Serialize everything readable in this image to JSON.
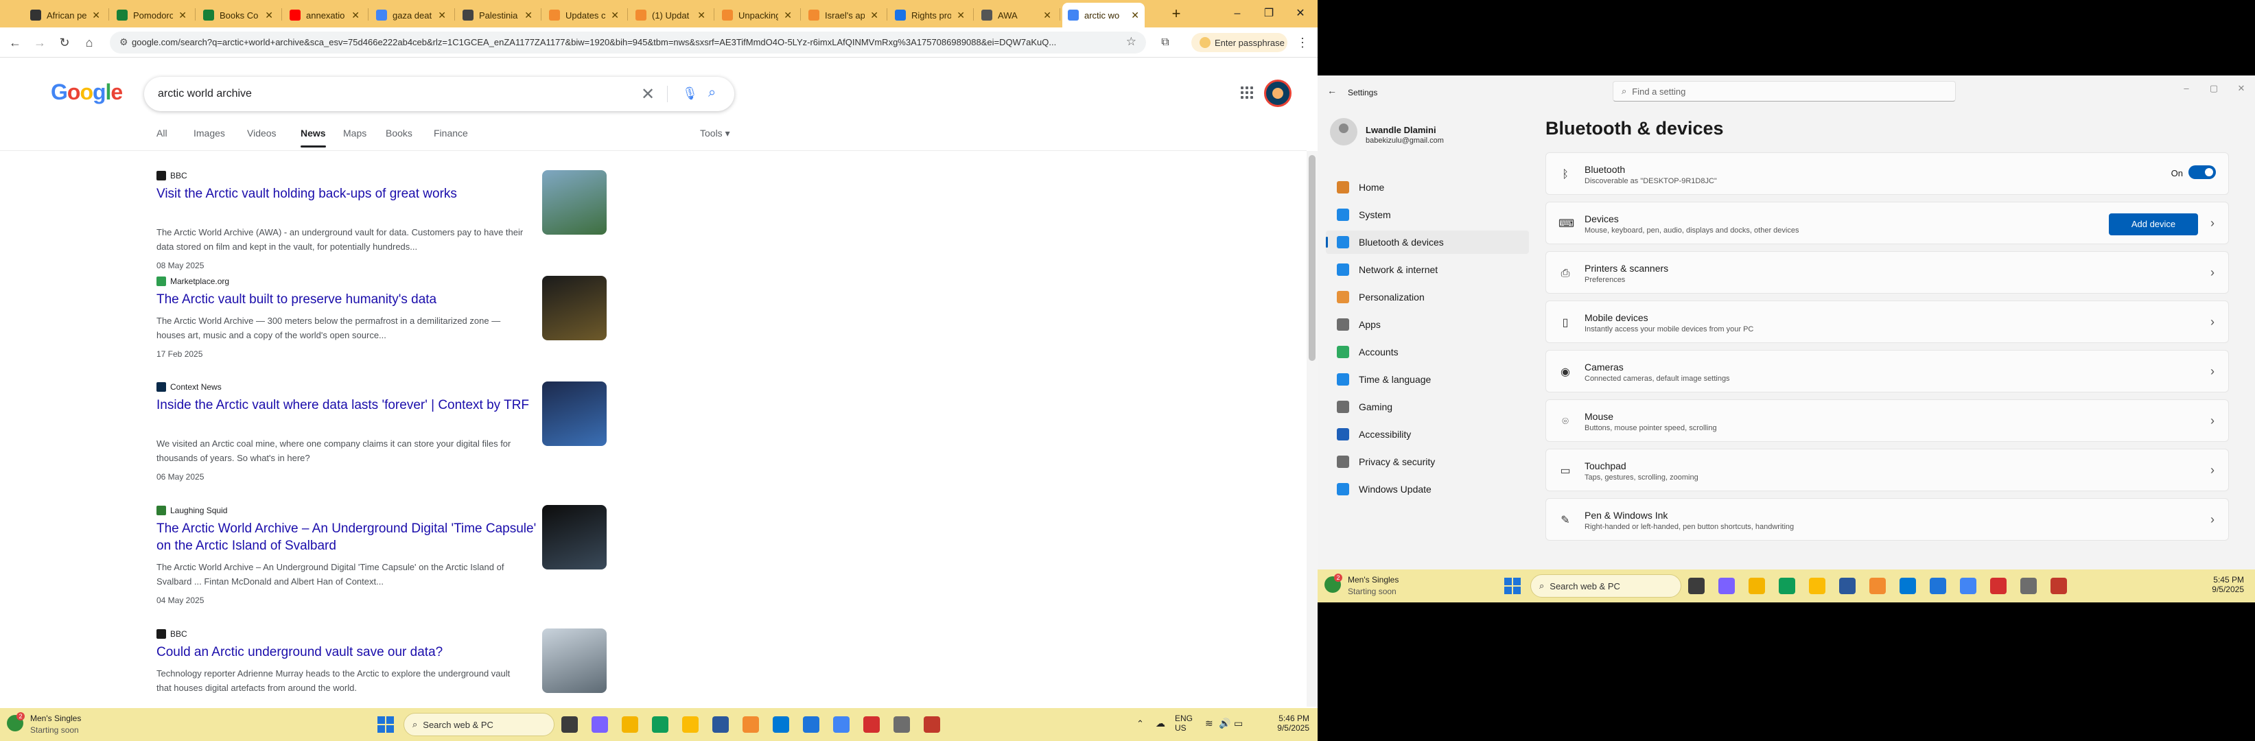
{
  "browser": {
    "tabs": [
      {
        "label": "African pe",
        "favicon_color": "#333333"
      },
      {
        "label": "Pomodoro",
        "favicon_color": "#188038"
      },
      {
        "label": "Books Co",
        "favicon_color": "#188038"
      },
      {
        "label": "annexatio",
        "favicon_color": "#ff0000"
      },
      {
        "label": "gaza deat",
        "favicon_color": "#4285f4"
      },
      {
        "label": "Palestinia",
        "favicon_color": "#444444"
      },
      {
        "label": "Updates c",
        "favicon_color": "#f28b30"
      },
      {
        "label": "(1) Updat",
        "favicon_color": "#f28b30"
      },
      {
        "label": "Unpacking",
        "favicon_color": "#f28b30"
      },
      {
        "label": "Israel's ap",
        "favicon_color": "#f28b30"
      },
      {
        "label": "Rights pro",
        "favicon_color": "#1a73e8"
      },
      {
        "label": "AWA",
        "favicon_color": "#555555"
      },
      {
        "label": "arctic wo",
        "favicon_color": "#4285f4",
        "active": true
      }
    ],
    "url": "google.com/search?q=arctic+world+archive&sca_esv=75d466e222ab4ceb&rlz=1C1GCEA_enZA1177ZA1177&biw=1920&bih=945&tbm=nws&sxsrf=AE3TifMmdO4O-5LYz-r6imxLAfQINMVmRxg%3A1757086989088&ei=DQW7aKuQ...",
    "passphrase_label": "Enter passphrase"
  },
  "google": {
    "logo": "Google",
    "query": "arctic world archive",
    "tabs": [
      "All",
      "Images",
      "Videos",
      "News",
      "Maps",
      "Books",
      "Finance"
    ],
    "active_tab": "News",
    "tools_label": "Tools",
    "results": [
      {
        "source": "BBC",
        "source_color": "#1a1a1a",
        "title": "Visit the Arctic vault holding back-ups of great works",
        "snippet": "The Arctic World Archive (AWA) - an underground vault for data. Customers pay to have their data stored on film and kept in the vault, for potentially hundreds...",
        "date": "08 May 2025",
        "thumb_colors": [
          "#7fa7c2",
          "#3e6f3f"
        ]
      },
      {
        "source": "Marketplace.org",
        "source_color": "#2e9e4f",
        "title": "The Arctic vault built to preserve humanity's data",
        "snippet": "The Arctic World Archive — 300 meters below the permafrost in a demilitarized zone — houses art, music and a copy of the world's open source...",
        "date": "17 Feb 2025",
        "thumb_colors": [
          "#1b1b1b",
          "#6e5a2a"
        ]
      },
      {
        "source": "Context News",
        "source_color": "#0a2a4a",
        "title": "Inside the Arctic vault where data lasts 'forever' | Context by TRF",
        "snippet": "We visited an Arctic coal mine, where one company claims it can store your digital files for thousands of years. So what's in here?",
        "date": "06 May 2025",
        "thumb_colors": [
          "#1c2a4d",
          "#3a6fb5"
        ]
      },
      {
        "source": "Laughing Squid",
        "source_color": "#2e7d32",
        "title": "The Arctic World Archive – An Underground Digital 'Time Capsule' on the Arctic Island of Svalbard",
        "snippet": "The Arctic World Archive – An Underground Digital 'Time Capsule' on the Arctic Island of Svalbard ... Fintan McDonald and Albert Han of Context...",
        "date": "04 May 2025",
        "thumb_colors": [
          "#0d0d0d",
          "#3a4a5a"
        ]
      },
      {
        "source": "BBC",
        "source_color": "#1a1a1a",
        "title": "Could an Arctic underground vault save our data?",
        "snippet": "Technology reporter Adrienne Murray heads to the Arctic to explore the underground vault that houses digital artefacts from around the world.",
        "date": "",
        "thumb_colors": [
          "#c9d3dc",
          "#5d6a74"
        ]
      }
    ]
  },
  "taskbar_left": {
    "weather_line1": "Men's Singles",
    "weather_line2": "Starting soon",
    "weather_badge": "2",
    "search_placeholder": "Search web & PC",
    "lang1": "ENG",
    "lang2": "US",
    "time": "5:46 PM",
    "date": "9/5/2025"
  },
  "settings": {
    "window_title": "Settings",
    "search_placeholder": "Find a setting",
    "user_name": "Lwandle Dlamini",
    "user_email": "babekizulu@gmail.com",
    "nav": [
      {
        "label": "Home",
        "icon_color": "#d9822b"
      },
      {
        "label": "System",
        "icon_color": "#1e88e5"
      },
      {
        "label": "Bluetooth & devices",
        "icon_color": "#1e88e5",
        "active": true
      },
      {
        "label": "Network & internet",
        "icon_color": "#1e88e5"
      },
      {
        "label": "Personalization",
        "icon_color": "#e69138"
      },
      {
        "label": "Apps",
        "icon_color": "#6d6d6d"
      },
      {
        "label": "Accounts",
        "icon_color": "#2eaa60"
      },
      {
        "label": "Time & language",
        "icon_color": "#1e88e5"
      },
      {
        "label": "Gaming",
        "icon_color": "#6d6d6d"
      },
      {
        "label": "Accessibility",
        "icon_color": "#1e5fb8"
      },
      {
        "label": "Privacy & security",
        "icon_color": "#6d6d6d"
      },
      {
        "label": "Windows Update",
        "icon_color": "#1e88e5"
      }
    ],
    "page_heading": "Bluetooth & devices",
    "bluetooth": {
      "title": "Bluetooth",
      "subtitle": "Discoverable as \"DESKTOP-9R1D8JC\"",
      "toggle_label": "On",
      "toggle_state": "on"
    },
    "devices": {
      "title": "Devices",
      "subtitle": "Mouse, keyboard, pen, audio, displays and docks, other devices",
      "add_label": "Add device"
    },
    "cards": [
      {
        "title": "Printers & scanners",
        "subtitle": "Preferences",
        "icon": "printer-icon"
      },
      {
        "title": "Mobile devices",
        "subtitle": "Instantly access your mobile devices from your PC",
        "icon": "phone-icon"
      },
      {
        "title": "Cameras",
        "subtitle": "Connected cameras, default image settings",
        "icon": "camera-icon"
      },
      {
        "title": "Mouse",
        "subtitle": "Buttons, mouse pointer speed, scrolling",
        "icon": "mouse-icon"
      },
      {
        "title": "Touchpad",
        "subtitle": "Taps, gestures, scrolling, zooming",
        "icon": "touchpad-icon"
      },
      {
        "title": "Pen & Windows Ink",
        "subtitle": "Right-handed or left-handed, pen button shortcuts, handwriting",
        "icon": "pen-icon"
      }
    ]
  },
  "taskbar_right": {
    "weather_line1": "Men's Singles",
    "weather_line2": "Starting soon",
    "weather_badge": "2",
    "search_placeholder": "Search web & PC",
    "time": "5:45 PM",
    "date": "9/5/2025"
  }
}
